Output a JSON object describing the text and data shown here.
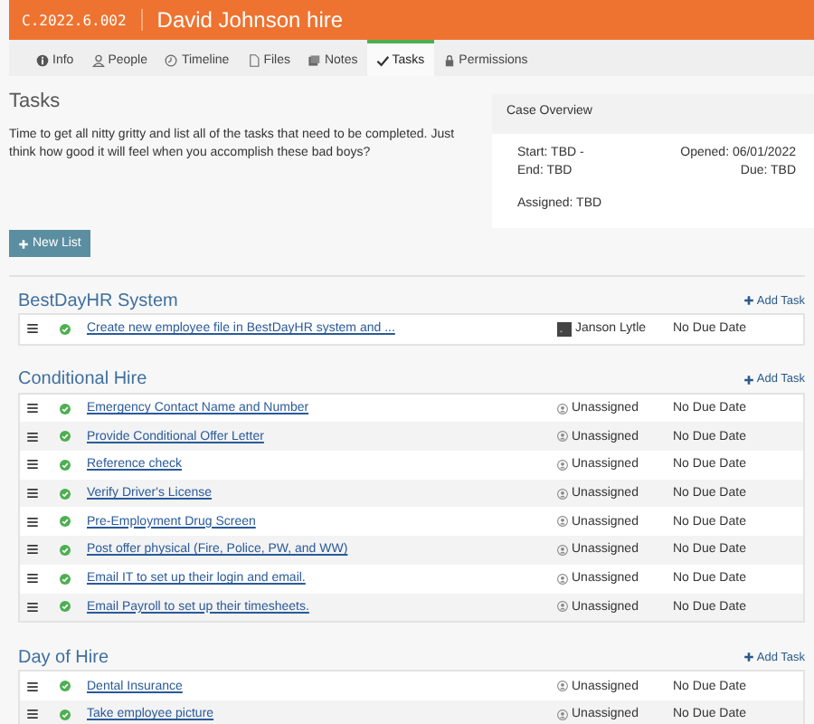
{
  "header": {
    "case_number": "C.2022.6.002",
    "title": "David Johnson hire"
  },
  "tabs": [
    {
      "label": "Info",
      "selected": false
    },
    {
      "label": "People",
      "selected": false
    },
    {
      "label": "Timeline",
      "selected": false
    },
    {
      "label": "Files",
      "selected": false
    },
    {
      "label": "Notes",
      "selected": false
    },
    {
      "label": "Tasks",
      "selected": true
    },
    {
      "label": "Permissions",
      "selected": false
    }
  ],
  "intro": {
    "title": "Tasks",
    "text": "Time to get all nitty gritty and list all of the tasks that need to be completed. Just think how good it will feel when you accomplish these bad boys?"
  },
  "case_overview": {
    "title": "Case Overview",
    "start": "Start: TBD -",
    "end": "End: TBD",
    "opened": "Opened: 06/01/2022",
    "due": "Due: TBD",
    "assigned": "Assigned: TBD"
  },
  "new_list_button": "New List",
  "task_lists": [
    {
      "name": "BestDayHR System",
      "add_label": "Add Task",
      "tasks": [
        {
          "title": "Create new employee file in BestDayHR system and ...",
          "completed": true,
          "assignee": {
            "kind": "user",
            "name": "Janson Lytle"
          },
          "due": "No Due Date"
        }
      ]
    },
    {
      "name": "Conditional Hire",
      "add_label": "Add Task",
      "tasks": [
        {
          "title": "Emergency Contact Name and Number",
          "completed": true,
          "assignee": {
            "kind": "unassigned",
            "name": "Unassigned"
          },
          "due": "No Due Date"
        },
        {
          "title": "Provide Conditional Offer Letter",
          "completed": true,
          "assignee": {
            "kind": "unassigned",
            "name": "Unassigned"
          },
          "due": "No Due Date"
        },
        {
          "title": "Reference check",
          "completed": true,
          "assignee": {
            "kind": "unassigned",
            "name": "Unassigned"
          },
          "due": "No Due Date"
        },
        {
          "title": "Verify Driver's License",
          "completed": true,
          "assignee": {
            "kind": "unassigned",
            "name": "Unassigned"
          },
          "due": "No Due Date"
        },
        {
          "title": "Pre-Employment Drug Screen",
          "completed": true,
          "assignee": {
            "kind": "unassigned",
            "name": "Unassigned"
          },
          "due": "No Due Date"
        },
        {
          "title": "Post offer physical (Fire, Police, PW, and WW)",
          "completed": true,
          "assignee": {
            "kind": "unassigned",
            "name": "Unassigned"
          },
          "due": "No Due Date"
        },
        {
          "title": "Email IT to set up their login and email.",
          "completed": true,
          "assignee": {
            "kind": "unassigned",
            "name": "Unassigned"
          },
          "due": "No Due Date"
        },
        {
          "title": "Email Payroll to set up their timesheets.",
          "completed": true,
          "assignee": {
            "kind": "unassigned",
            "name": "Unassigned"
          },
          "due": "No Due Date"
        }
      ]
    },
    {
      "name": "Day of Hire",
      "add_label": "Add Task",
      "tasks": [
        {
          "title": "Dental Insurance",
          "completed": true,
          "assignee": {
            "kind": "unassigned",
            "name": "Unassigned"
          },
          "due": "No Due Date"
        },
        {
          "title": "Take employee picture",
          "completed": true,
          "assignee": {
            "kind": "unassigned",
            "name": "Unassigned"
          },
          "due": "No Due Date"
        }
      ]
    }
  ]
}
